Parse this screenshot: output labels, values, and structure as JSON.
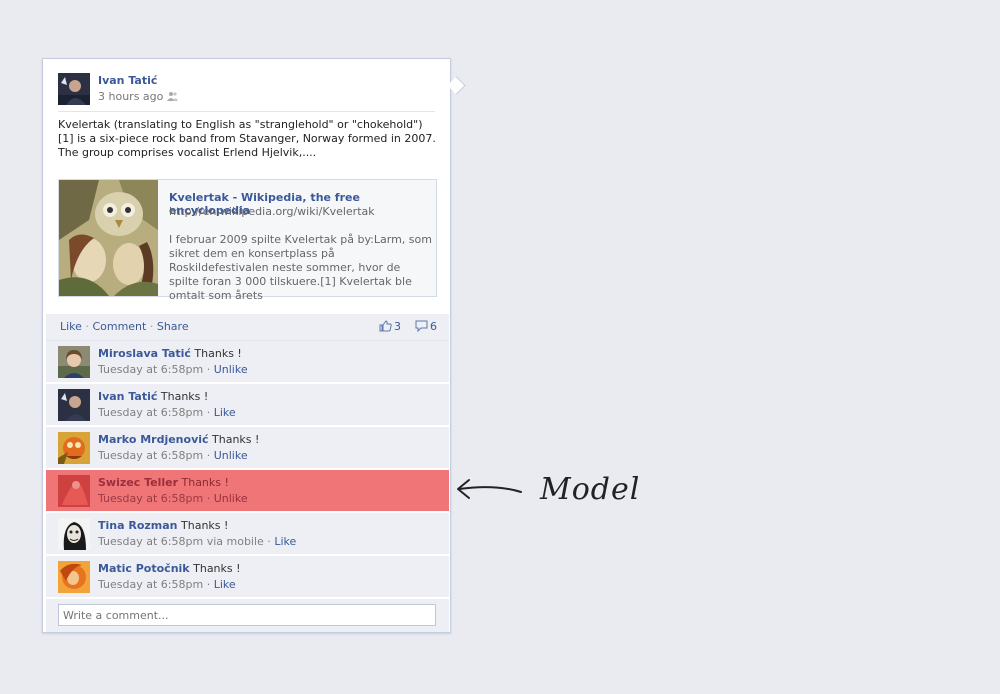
{
  "post": {
    "author": "Ivan Tatić",
    "time": "3 hours ago",
    "privacy_icon": "people-icon",
    "text": "Kvelertak (translating to English as \"stranglehold\" or \"chokehold\")[1] is a six-piece rock band from Stavanger, Norway formed in 2007. The group comprises vocalist Erlend Hjelvik,....",
    "link": {
      "title": "Kvelertak - Wikipedia, the free encyclopedia",
      "url": "http://en.wikipedia.org/wiki/Kvelertak",
      "description": "I februar 2009 spilte Kvelertak på by:Larm, som sikret dem en konsertplass på Roskildefestivalen neste sommer, hvor de spilte foran 3 000 tilskuere.[1] Kvelertak ble omtalt som årets"
    }
  },
  "actions": {
    "like": "Like",
    "comment": "Comment",
    "share": "Share",
    "separator": "·",
    "likes_count": "3",
    "comments_count": "6"
  },
  "comments": [
    {
      "name": "Miroslava Tatić",
      "text": "Thanks !",
      "meta": "Tuesday at 6:58pm ·",
      "action": "Unlike"
    },
    {
      "name": "Ivan Tatić",
      "text": "Thanks !",
      "meta": "Tuesday at 6:58pm ·",
      "action": "Like"
    },
    {
      "name": "Marko Mrdjenović",
      "text": "Thanks !",
      "meta": "Tuesday at 6:58pm ·",
      "action": "Unlike"
    },
    {
      "name": "Swizec Teller",
      "text": "Thanks !",
      "meta": "Tuesday at 6:58pm ·",
      "action": "Unlike"
    },
    {
      "name": "Tina Rozman",
      "text": "Thanks !",
      "meta": "Tuesday at 6:58pm via mobile ·",
      "action": "Like"
    },
    {
      "name": "Matic Potočnik",
      "text": "Thanks !",
      "meta": "Tuesday at 6:58pm ·",
      "action": "Like"
    }
  ],
  "comment_input": {
    "placeholder": "Write a comment..."
  },
  "annotation": {
    "label": "Model"
  },
  "colors": {
    "link": "#3b5998",
    "highlight": "#ef7577",
    "background": "#e9ebf0"
  }
}
